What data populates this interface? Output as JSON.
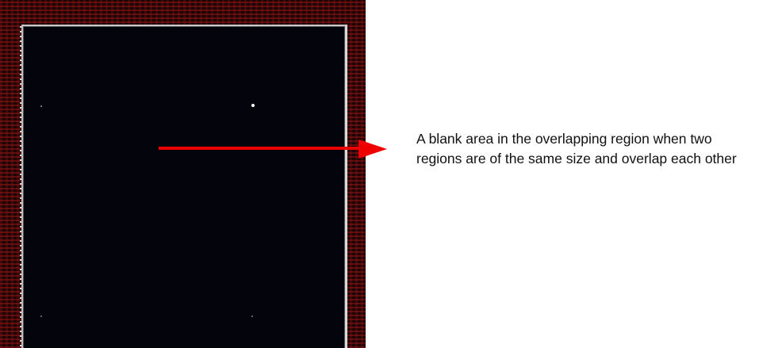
{
  "annotation": {
    "text": "A blank area in the overlapping region when two regions are of the same size and overlap each other"
  },
  "colors": {
    "arrow": "#ee0000",
    "region_fill": "#04050c",
    "background_pattern": "#961414",
    "text": "#111111"
  }
}
